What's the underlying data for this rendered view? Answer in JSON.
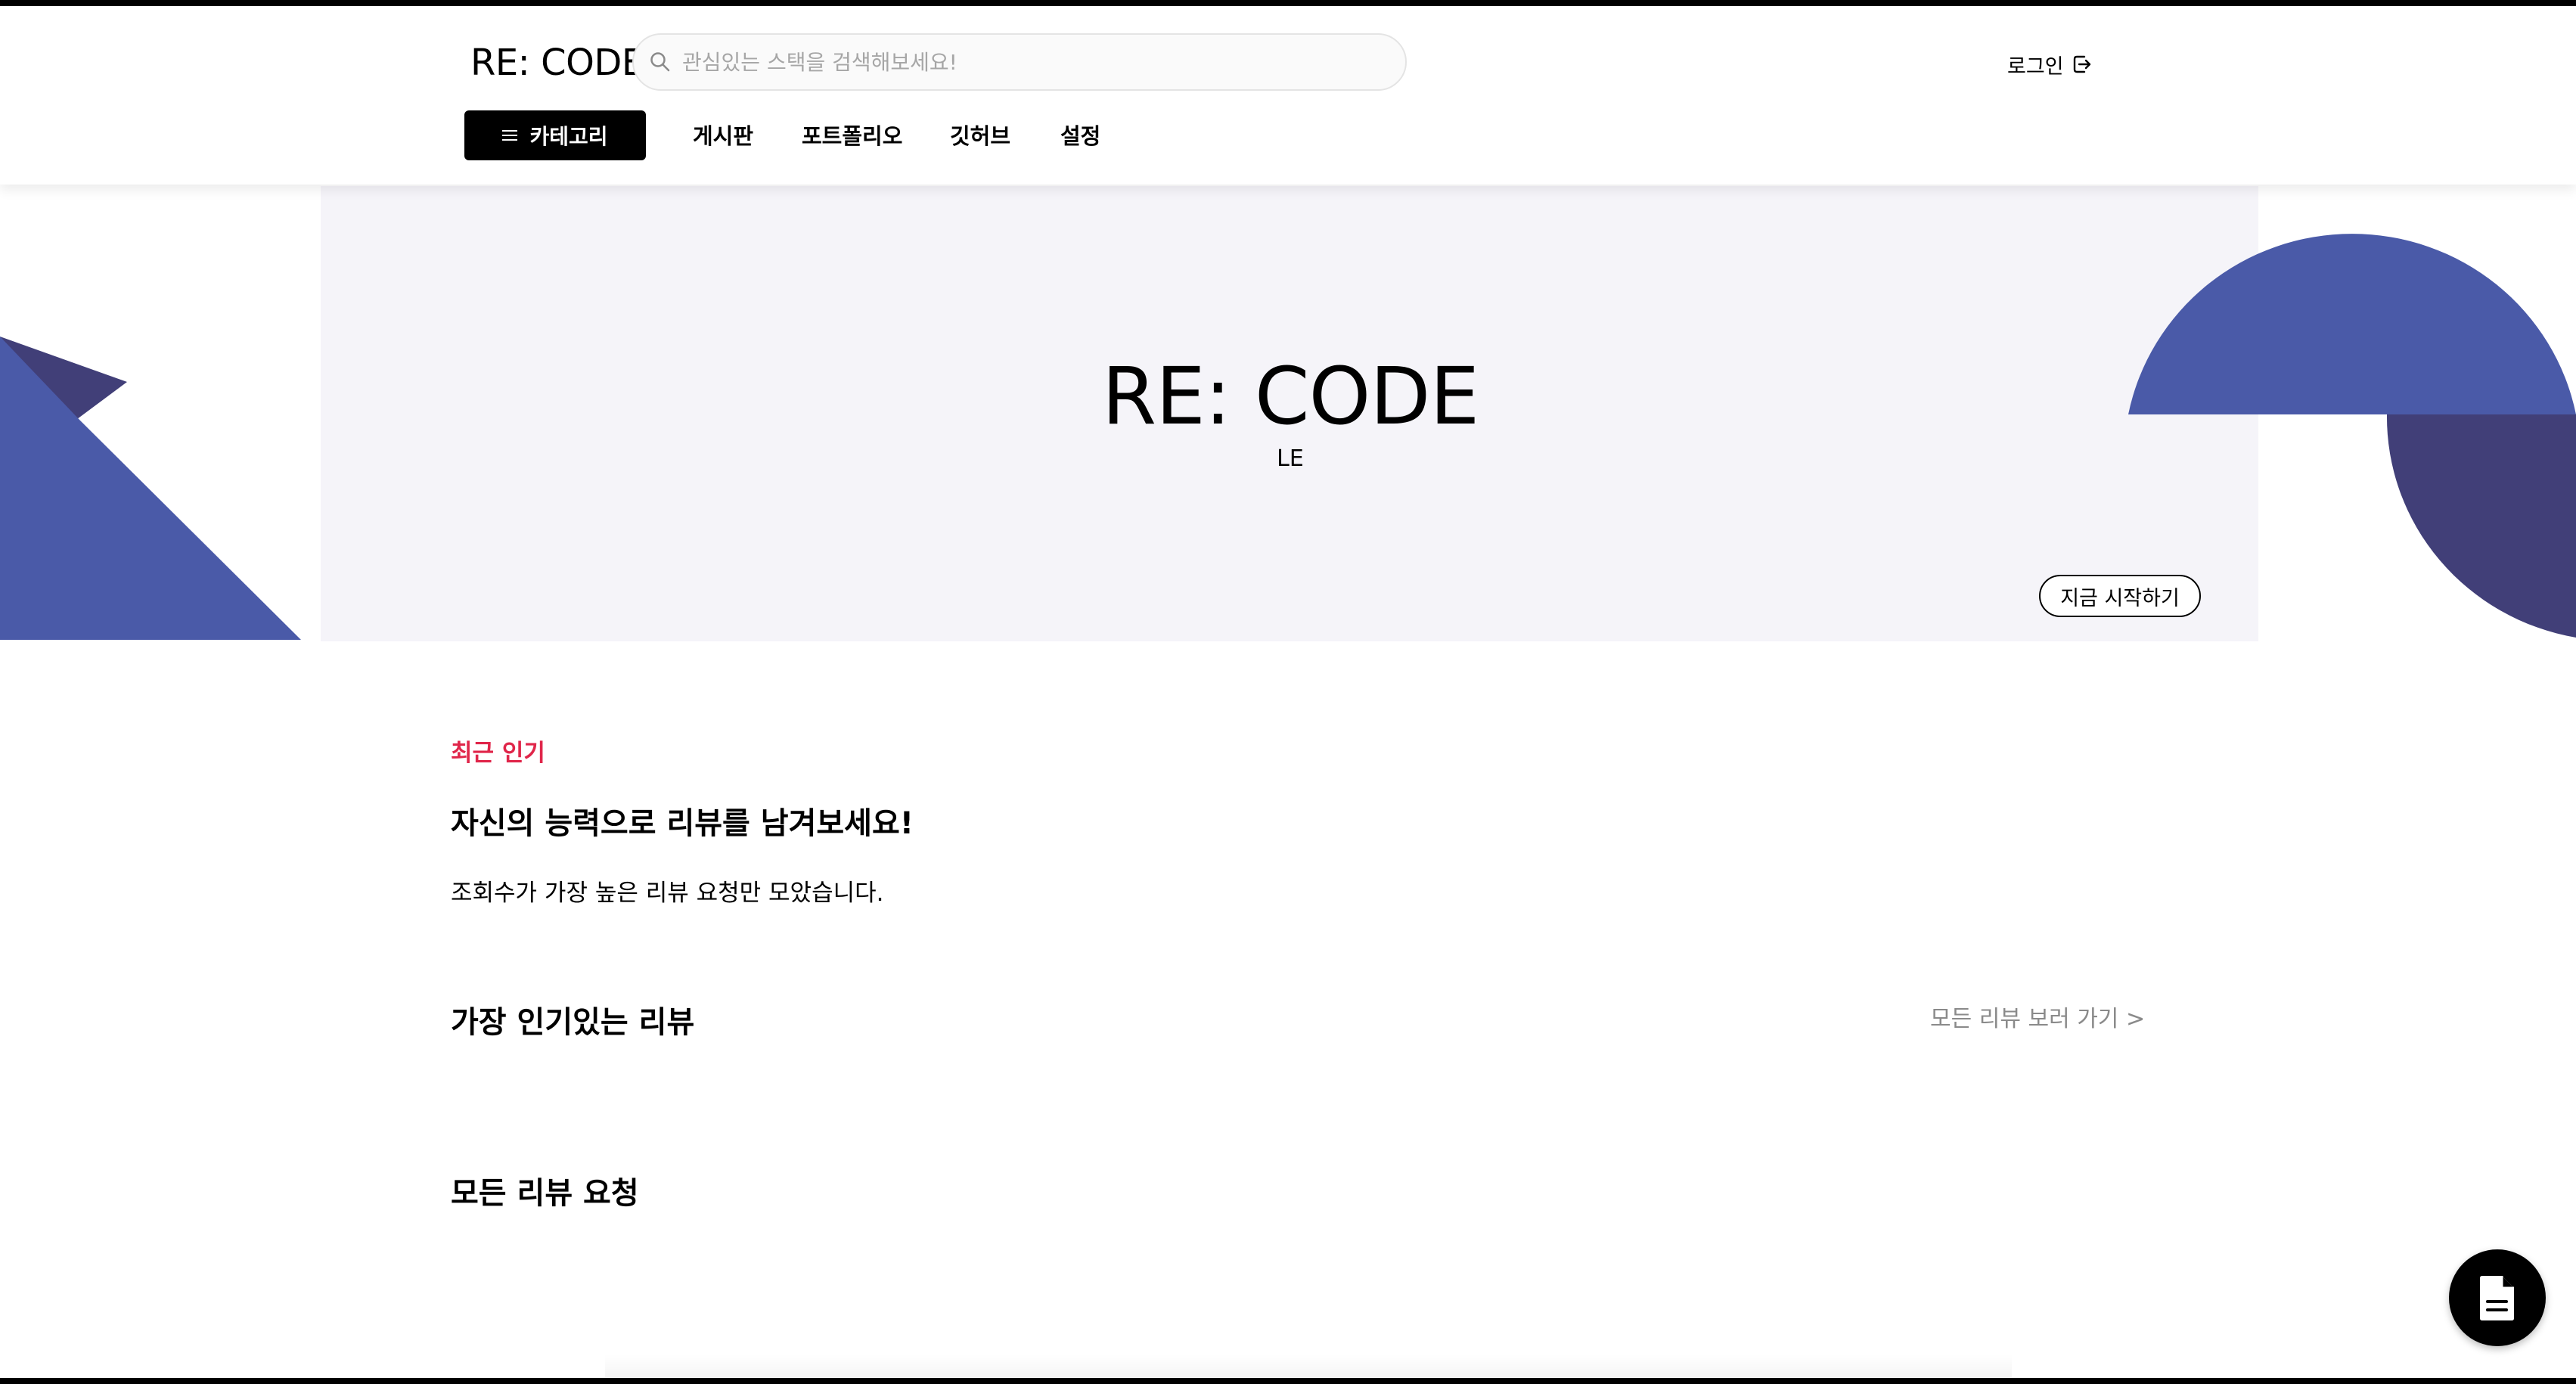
{
  "header": {
    "logo": "RE: CODE",
    "search_placeholder": "관심있는 스택을 검색해보세요!",
    "login_label": "로그인"
  },
  "nav": {
    "category_label": "카테고리",
    "items": [
      "게시판",
      "포트폴리오",
      "깃허브",
      "설정"
    ]
  },
  "hero": {
    "title": "RE: CODE",
    "subtitle": "LE",
    "start_label": "지금 시작하기"
  },
  "content": {
    "recent_tag": "최근 인기",
    "headline": "자신의 능력으로 리뷰를 남겨보세요!",
    "description": "조회수가 가장 높은 리뷰 요청만 모았습니다.",
    "popular_title": "가장 인기있는 리뷰",
    "see_all_label": "모든 리뷰 보러 가기 >",
    "all_requests_title": "모든 리뷰 요청"
  },
  "colors": {
    "accent_red": "#e0264a",
    "deco_blue": "#4a5aa8",
    "deco_navy": "#413f78",
    "hero_bg": "#f5f4f9"
  },
  "icons": {
    "search": "search-icon",
    "login": "login-icon",
    "menu": "menu-icon",
    "fab": "document-icon"
  }
}
